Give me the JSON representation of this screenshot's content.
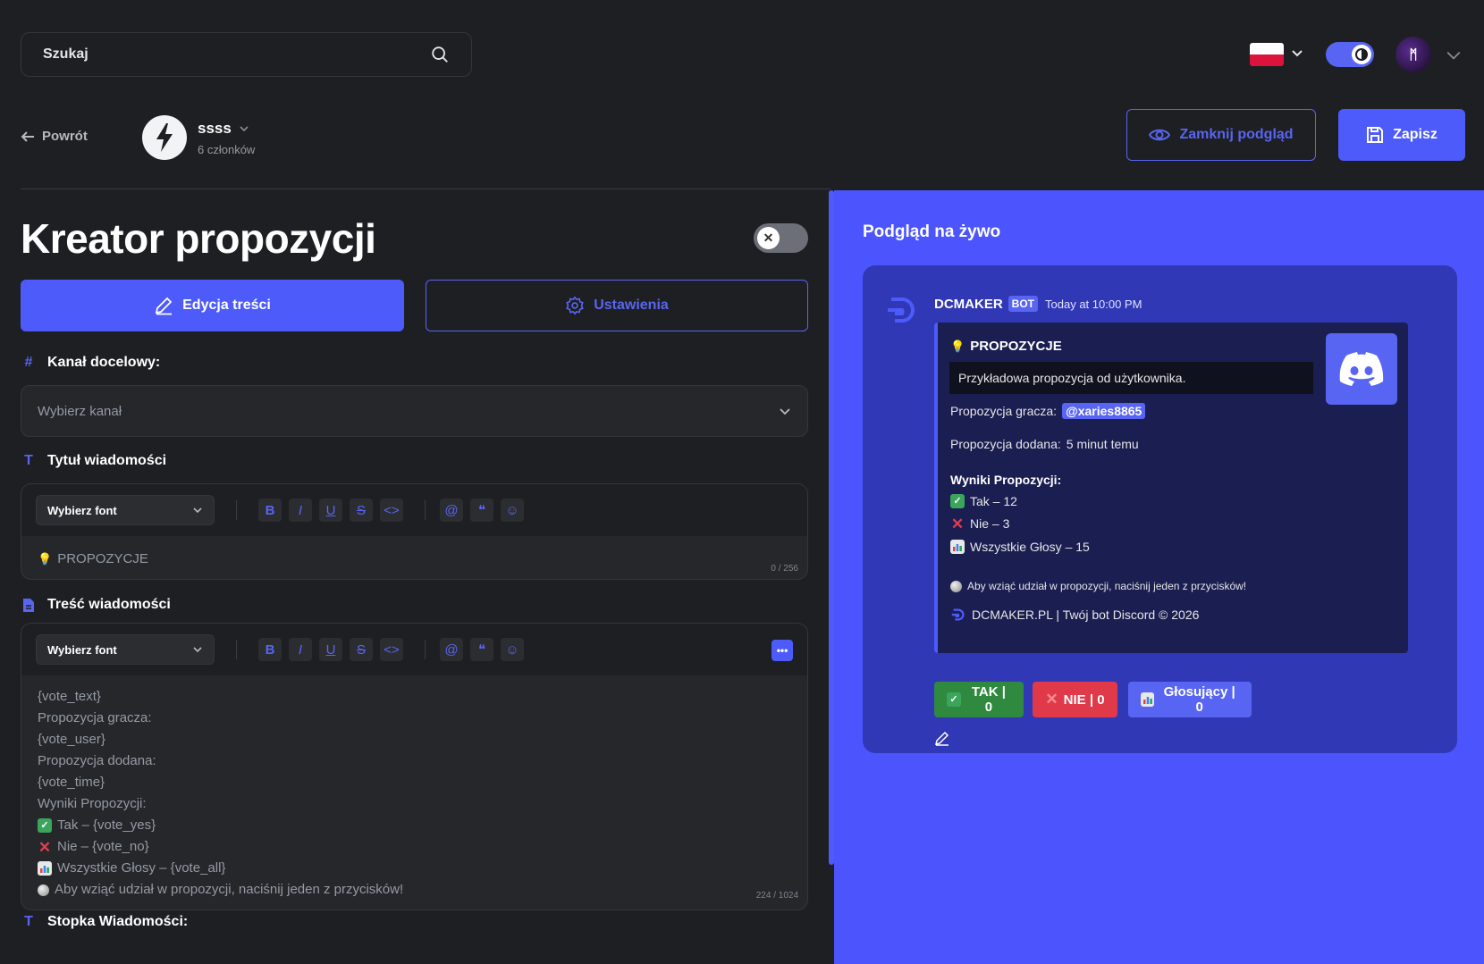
{
  "search": {
    "placeholder": "Szukaj"
  },
  "top_right": {
    "language": "PL",
    "avatar_text": "ᛗ"
  },
  "header": {
    "back_label": "Powrót",
    "server_name": "ssss",
    "server_members": "6 członków",
    "preview_button": "Zamknij podgląd",
    "save_button": "Zapisz"
  },
  "editor": {
    "title": "Kreator propozycji",
    "tabs": {
      "edit": "Edycja treści",
      "settings": "Ustawienia"
    },
    "channel": {
      "label": "Kanał docelowy:",
      "placeholder": "Wybierz kanał"
    },
    "msg_title": {
      "label": "Tytuł wiadomości",
      "font_select": "Wybierz font",
      "value": "PROPOZYCJE",
      "counter": "0 / 256"
    },
    "msg_content": {
      "label": "Treść wiadomości",
      "font_select": "Wybierz font",
      "lines": [
        "{vote_text}",
        "Propozycja gracza:",
        "{vote_user}",
        "Propozycja dodana:",
        "{vote_time}",
        "Wyniki Propozycji:",
        "Tak – {vote_yes}",
        "Nie – {vote_no}",
        "Wszystkie Głosy – {vote_all}",
        "Aby wziąć udział w propozycji, naciśnij jeden z przycisków!"
      ],
      "counter": "224 / 1024"
    },
    "footer_label": "Stopka Wiadomości:"
  },
  "preview": {
    "title": "Podgląd na żywo",
    "bot_name": "DCMAKER",
    "bot_badge": "BOT",
    "time": "Today at 10:00 PM",
    "embed": {
      "title": "PROPOZYCJE",
      "text": "Przykładowa propozycja od użytkownika.",
      "player_label": "Propozycja gracza:",
      "player_mention": "@xaries8865",
      "added_label": "Propozycja dodana:",
      "added_value": "5 minut temu",
      "results_label": "Wyniki Propozycji:",
      "yes": "Tak – 12",
      "no": "Nie – 3",
      "all": "Wszystkie Głosy – 15",
      "hint": "Aby wziąć udział w propozycji, naciśnij jeden z przycisków!",
      "footer": "DCMAKER.PL | Twój bot Discord © 2026"
    },
    "buttons": {
      "yes": "TAK | 0",
      "no": "NIE | 0",
      "voters": "Głosujący | 0"
    }
  },
  "colors": {
    "accent": "#4c5bfa",
    "bg": "#1e1f22",
    "preview_bg": "#4c55fd",
    "green": "#2f8a3f",
    "red": "#e03a4a"
  }
}
